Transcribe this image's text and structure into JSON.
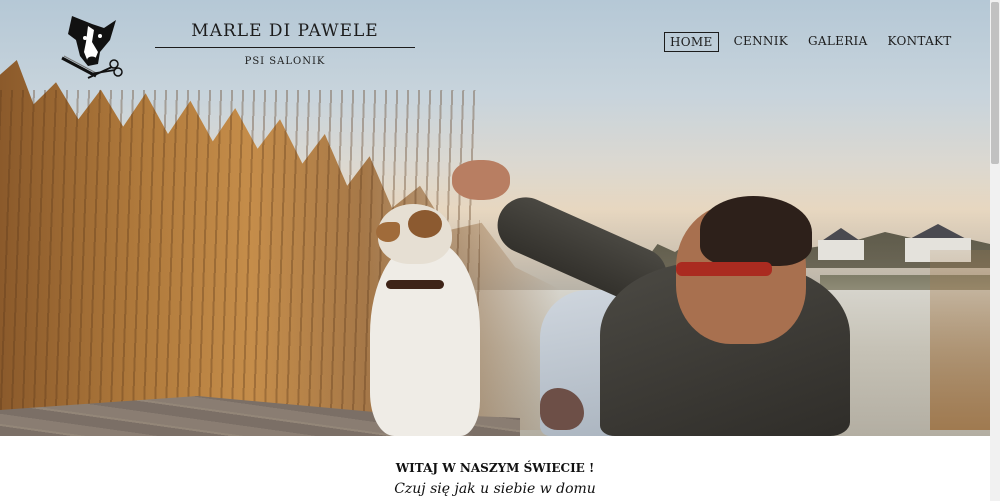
{
  "header": {
    "brand_title": "MARLE DI PAWELE",
    "brand_subtitle": "PSI SALONIK",
    "logo_icon": "dog-grooming-logo-icon"
  },
  "nav": {
    "items": [
      {
        "label": "HOME",
        "active": true
      },
      {
        "label": "CENNIK",
        "active": false
      },
      {
        "label": "GALERIA",
        "active": false
      },
      {
        "label": "KONTAKT",
        "active": false
      }
    ]
  },
  "main": {
    "welcome": "WITAJ W NASZYM ŚWIECIE !",
    "tagline": "Czuj się jak u siebie w domu"
  },
  "colors": {
    "text": "#1c1c1c",
    "background": "#ffffff"
  }
}
